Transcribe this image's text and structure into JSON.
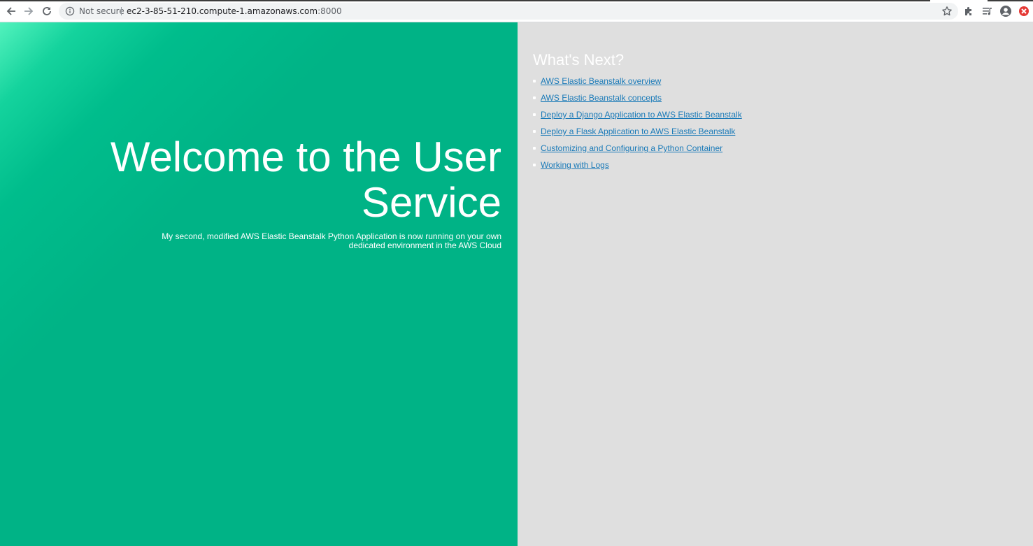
{
  "browser": {
    "security_label": "Not secure",
    "url_host": "ec2-3-85-51-210.compute-1.amazonaws.com",
    "url_port": ":8000",
    "icons": [
      "back-arrow-icon",
      "forward-arrow-icon",
      "reload-icon",
      "info-icon",
      "star-icon",
      "extensions-puzzle-icon",
      "reading-list-icon",
      "profile-avatar-icon",
      "extension-red-icon"
    ]
  },
  "hero": {
    "title": "Welcome to the User Service",
    "subtitle": "My second, modified AWS Elastic Beanstalk Python Application is now running on your own dedicated environment in the AWS Cloud"
  },
  "next": {
    "title": "What's Next?",
    "links": [
      {
        "label": "AWS Elastic Beanstalk overview"
      },
      {
        "label": "AWS Elastic Beanstalk concepts"
      },
      {
        "label": "Deploy a Django Application to AWS Elastic Beanstalk"
      },
      {
        "label": "Deploy a Flask Application to AWS Elastic Beanstalk"
      },
      {
        "label": "Customizing and Configuring a Python Container"
      },
      {
        "label": "Working with Logs"
      }
    ]
  },
  "colors": {
    "hero_green": "#00b386",
    "right_panel_bg": "#dfdfdf",
    "link": "#1a7ab8"
  }
}
